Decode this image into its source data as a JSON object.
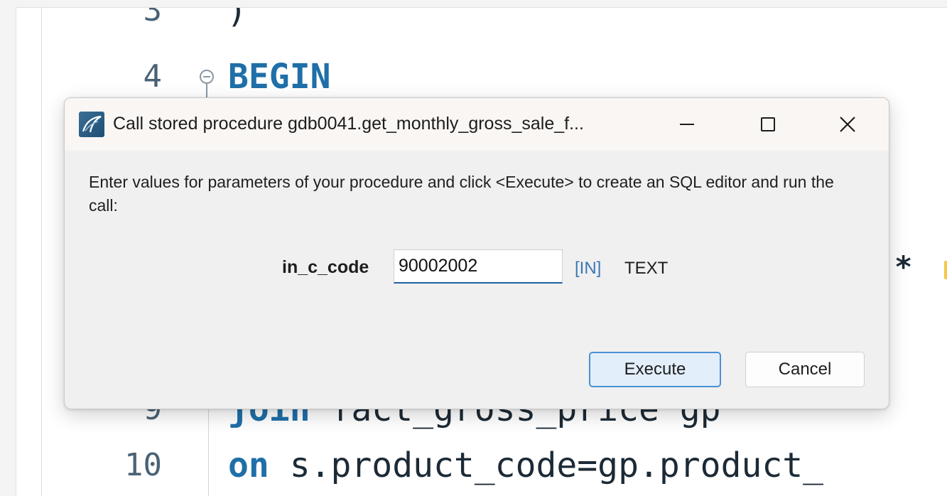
{
  "editor": {
    "lines": [
      {
        "number": "3",
        "keyword": "",
        "text": ")"
      },
      {
        "number": "4",
        "keyword": "BEGIN",
        "text": ""
      },
      {
        "number": "9",
        "keyword": "join",
        "text": " fact_gross_price gp"
      },
      {
        "number": "10",
        "keyword": "on",
        "text": " s.product_code=gp.product_"
      }
    ],
    "partial_marker": "*"
  },
  "dialog": {
    "title": "Call stored procedure gdb0041.get_monthly_gross_sale_f...",
    "instructions": "Enter values for parameters of your procedure and click <Execute> to create an SQL editor and run the call:",
    "parameter": {
      "name": "in_c_code",
      "value": "90002002",
      "direction": "[IN]",
      "type": "TEXT"
    },
    "execute_label": "Execute",
    "cancel_label": "Cancel"
  },
  "colors": {
    "keyword": "#1f6fa8",
    "accent": "#4a90d2"
  },
  "icons": [
    "app-logo-icon",
    "fold-collapse-icon",
    "minimize-icon",
    "maximize-icon",
    "close-icon"
  ]
}
